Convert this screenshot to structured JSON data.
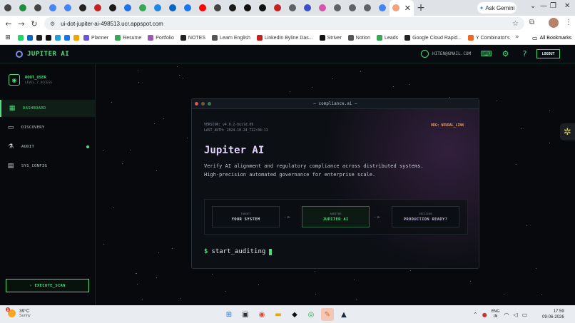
{
  "browser": {
    "tab_favicon_colors": [
      "#444444",
      "#1e8e3e",
      "#444444",
      "#4285f4",
      "#4285f4",
      "#222222",
      "#c5221f",
      "#1a1a1a",
      "#1a73e8",
      "#34a853",
      "#1e88e5",
      "#0a66c2",
      "#1877f2",
      "#ff0000",
      "#444444",
      "#1a1a1a",
      "#111111",
      "#111111",
      "#c5221f",
      "#5f6368",
      "#3c4ec9",
      "#d455a8",
      "#5f6368",
      "#5f6368",
      "#5f6368",
      "#4285f4",
      "#f08a5d"
    ],
    "active_tab_close": "✕",
    "new_tab": "+",
    "ask_gemini": "Ask Gemini",
    "url": "ui-dot-jupiter-ai-498513.ucr.appspot.com",
    "bookmarks": [
      {
        "label": "Planner",
        "color": "#6b57d6"
      },
      {
        "label": "Resume",
        "color": "#34a853"
      },
      {
        "label": "Portfolio",
        "color": "#9b59b6"
      },
      {
        "label": "NOTES",
        "color": "#222222"
      },
      {
        "label": "Learn English",
        "color": "#555555"
      },
      {
        "label": "LinkedIn Byline Das...",
        "color": "#c5221f"
      },
      {
        "label": "Striver",
        "color": "#111111"
      },
      {
        "label": "Notion",
        "color": "#555555"
      },
      {
        "label": "Leads",
        "color": "#34a853"
      },
      {
        "label": "Google Cloud Rapid...",
        "color": "#222222"
      },
      {
        "label": "Y Combinator's",
        "color": "#f26522"
      }
    ],
    "bookmark_icon_colors": [
      "#25d366",
      "#0a66c2",
      "#222222",
      "#111111",
      "#229ed9",
      "#1a73e8",
      "#f4a300"
    ],
    "all_bookmarks": "All Bookmarks"
  },
  "app": {
    "brand": "JUPITER AI",
    "user_email": "HITEN@GMAIL.COM",
    "logout": "LOGOUT",
    "sidebar": {
      "user_name": "ROOT_USER",
      "user_level": "LEVEL_7_ACCESS",
      "items": [
        {
          "label": "DASHBOARD",
          "icon": "dashboard-icon",
          "active": true
        },
        {
          "label": "DISCOVERY",
          "icon": "chat-icon",
          "active": false
        },
        {
          "label": "AUDIT",
          "icon": "flask-icon",
          "active": false
        },
        {
          "label": "SYS_CONFIG",
          "icon": "settings-panel-icon",
          "active": false
        }
      ],
      "execute": "› EXECUTE_SCAN"
    },
    "terminal": {
      "title": "— compliance.ai —",
      "version": "VERSION: v4.0.2-build.09",
      "last_auth": "LAST_AUTH: 2024-10-24_T22:04:11",
      "org": "ORG: NEURAL_LINK",
      "heading": "Jupiter AI",
      "description": "Verify AI alignment and regulatory compliance across distributed systems. High-precision automated governance for enterprise scale.",
      "steps": [
        {
          "key": "TARGET",
          "value": "YOUR SYSTEM"
        },
        {
          "key": "AUDITOR",
          "value": "JUPITER AI"
        },
        {
          "key": "DECISION",
          "value": "PRODUCTION READY?"
        }
      ],
      "prompt_sign": "$",
      "command": "start_auditing"
    }
  },
  "taskbar": {
    "badge": "1",
    "temperature": "39°C",
    "condition": "Sunny",
    "lang_top": "ENG",
    "lang_bottom": "IN",
    "time": "17:59",
    "date": "09-06-2026"
  }
}
